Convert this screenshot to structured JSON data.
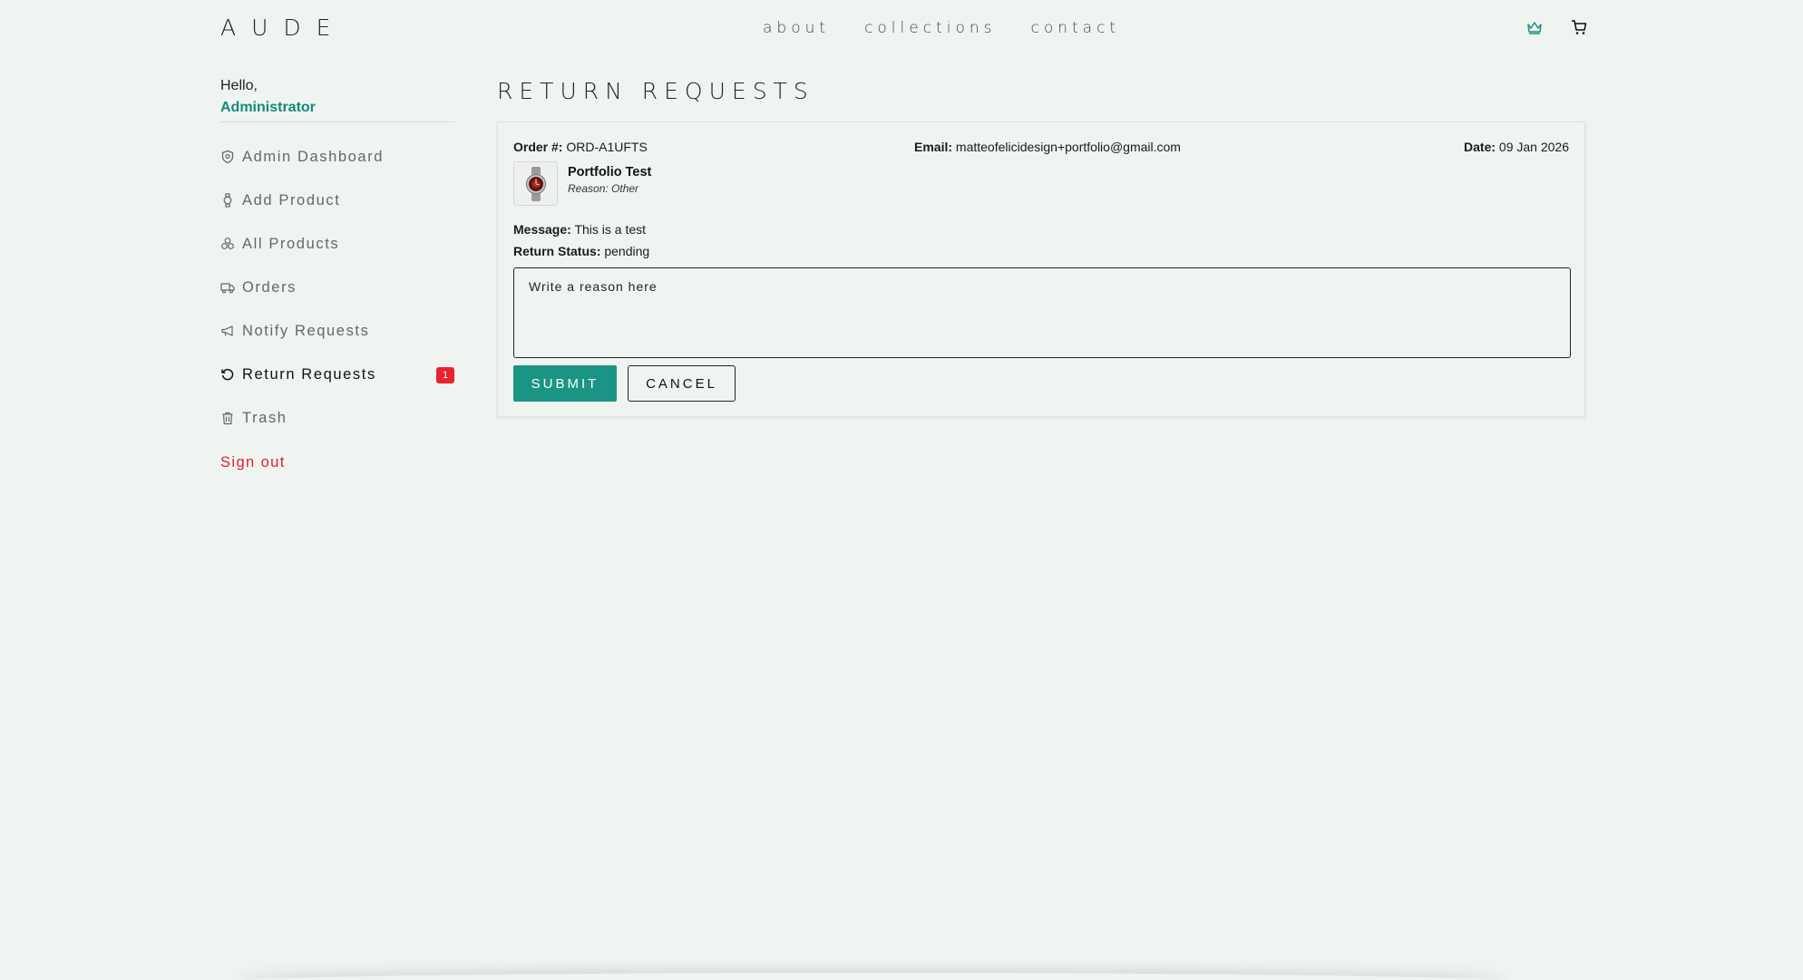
{
  "brand": {
    "logo": "AUDE"
  },
  "nav": {
    "items": [
      "about",
      "collections",
      "contact"
    ]
  },
  "header_icons": {
    "crown": "crown-icon",
    "cart": "cart-icon",
    "accent": "#1a9585"
  },
  "sidebar": {
    "greeting": "Hello,",
    "user": "Administrator",
    "items": [
      {
        "label": "Admin Dashboard",
        "icon": "shield-icon"
      },
      {
        "label": "Add Product",
        "icon": "watch-icon"
      },
      {
        "label": "All Products",
        "icon": "grid-icon"
      },
      {
        "label": "Orders",
        "icon": "truck-icon"
      },
      {
        "label": "Notify Requests",
        "icon": "megaphone-icon"
      },
      {
        "label": "Return Requests",
        "icon": "refresh-icon",
        "badge": "1",
        "active": true
      },
      {
        "label": "Trash",
        "icon": "trash-icon"
      }
    ],
    "signout": "Sign out"
  },
  "main": {
    "title": "RETURN REQUESTS",
    "request": {
      "order_label": "Order #:",
      "order_value": "ORD-A1UFTS",
      "email_label": "Email:",
      "email_value": "matteofelicidesign+portfolio@gmail.com",
      "date_label": "Date:",
      "date_value": "09 Jan 2026",
      "product_name": "Portfolio Test",
      "product_reason": "Reason: Other",
      "message_label": "Message:",
      "message_value": "This is a test",
      "status_label": "Return Status:",
      "status_value": "pending",
      "reason_placeholder": "Write a reason here",
      "submit_label": "SUBMIT",
      "cancel_label": "CANCEL"
    }
  },
  "colors": {
    "accent": "#1a9585",
    "danger": "#e0202d",
    "background": "#f0f4f1"
  }
}
